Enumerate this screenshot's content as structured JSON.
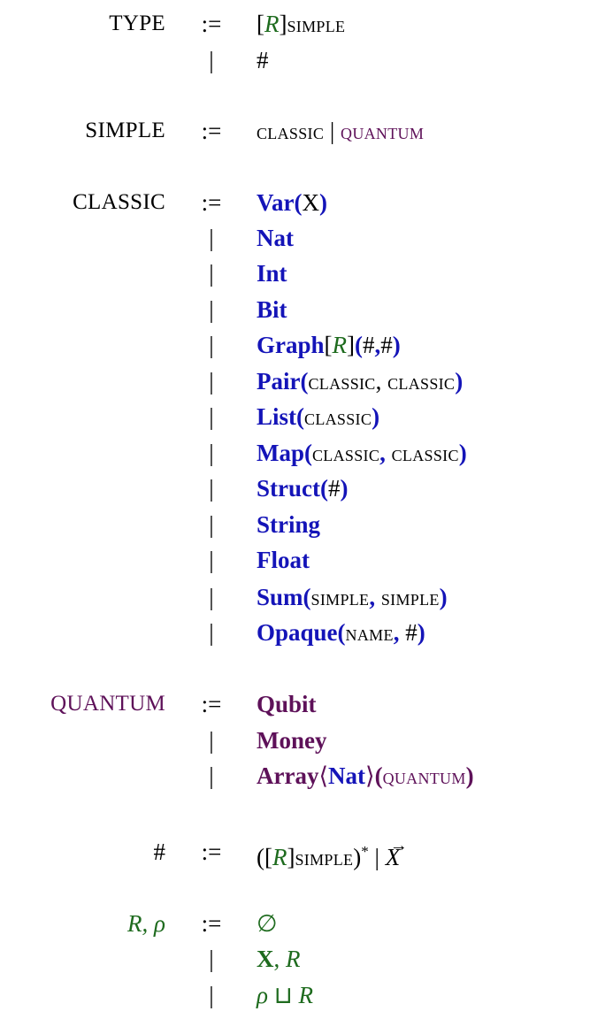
{
  "ops": {
    "def": ":=",
    "alt": "|"
  },
  "labels": {
    "type": "TYPE",
    "simple": "SIMPLE",
    "classic": "CLASSIC",
    "quantum": "QUANTUM",
    "name": "NAME",
    "hash": "#",
    "r": "R",
    "rho": "ρ",
    "x": "X"
  },
  "constructors": {
    "var": "Var",
    "nat": "Nat",
    "int": "Int",
    "bit": "Bit",
    "graph": "Graph",
    "pair": "Pair",
    "list": "List",
    "map": "Map",
    "struct": "Struct",
    "string": "String",
    "float": "Float",
    "sum": "Sum",
    "opaque": "Opaque",
    "qubit": "Qubit",
    "money": "Money",
    "array": "Array"
  },
  "symbols": {
    "empty_set": "∅",
    "square_cup": "⊔",
    "star": "*"
  },
  "colors": {
    "classic_constructor": "#1414b8",
    "quantum_constructor": "#5e1159",
    "region": "#1e6b1e"
  }
}
